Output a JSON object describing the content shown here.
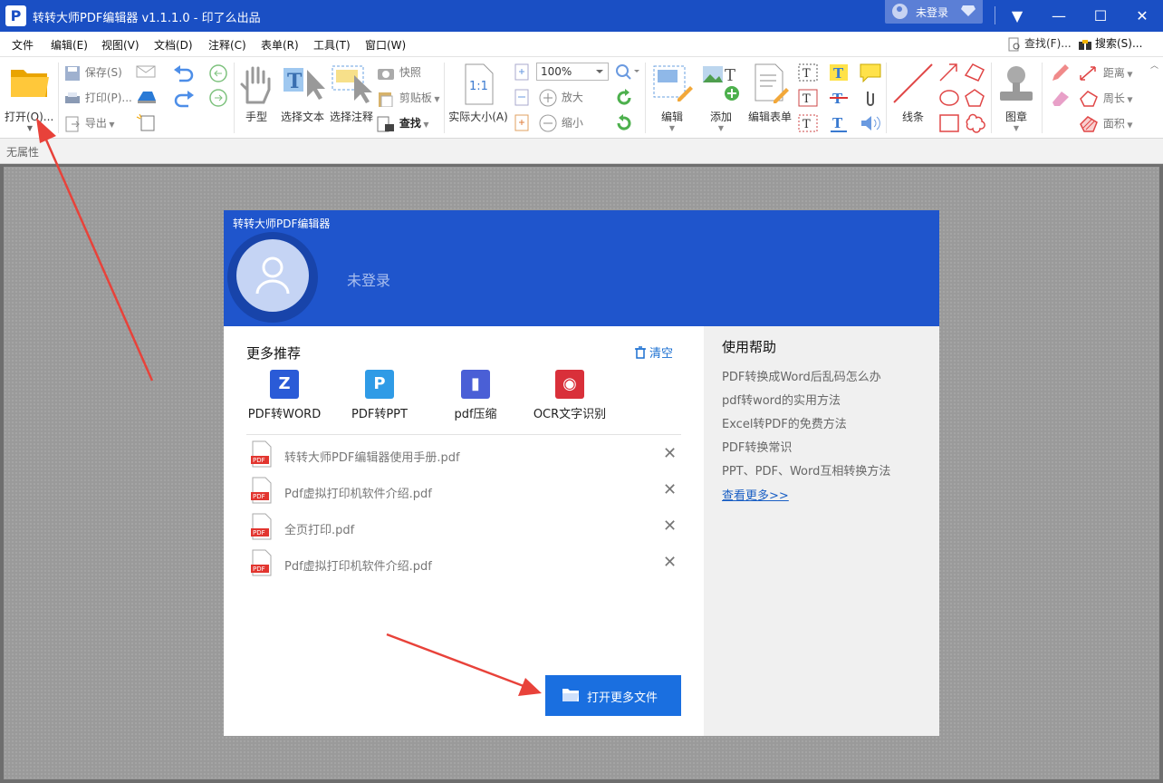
{
  "app": {
    "title": "转转大师PDF编辑器 v1.1.1.0 - 印了么出品",
    "logo_letter": "P",
    "login_label": "未登录",
    "window_controls": [
      "▼",
      "—",
      "☐",
      "✕"
    ]
  },
  "menu": {
    "items": [
      "文件",
      "编辑(E)",
      "视图(V)",
      "文档(D)",
      "注释(C)",
      "表单(R)",
      "工具(T)",
      "窗口(W)"
    ],
    "find_label": "查找(F)...",
    "search_label": "搜索(S)..."
  },
  "ribbon": {
    "open_label": "打开(O)...",
    "save_label": "保存(S)",
    "print_label": "打印(P)...",
    "export_label": "导出",
    "hand_label": "手型",
    "select_text_label": "选择文本",
    "select_annot_label": "选择注释",
    "snapshot_label": "快照",
    "clipboard_label": "剪贴板",
    "find_label": "查找",
    "actual_size_label": "实际大小(A)",
    "zoom_value": "100%",
    "zoom_in_label": "放大",
    "zoom_out_label": "缩小",
    "edit_label": "编辑",
    "add_label": "添加",
    "edit_form_label": "编辑表单",
    "lines_label": "线条",
    "stamp_label": "图章",
    "distance_label": "距离",
    "perimeter_label": "周长",
    "area_label": "面积"
  },
  "propbar": {
    "text": "无属性"
  },
  "dialog": {
    "title": "转转大师PDF编辑器",
    "user_status": "未登录",
    "recommend_title": "更多推荐",
    "clear_label": "清空",
    "tools": [
      {
        "label": "PDF转WORD",
        "color": "#2a5bd7",
        "glyph": "Z"
      },
      {
        "label": "PDF转PPT",
        "color": "#2f9be6",
        "glyph": "P"
      },
      {
        "label": "pdf压缩",
        "color": "#4a5fd6",
        "glyph": "▮"
      },
      {
        "label": "OCR文字识别",
        "color": "#d9303a",
        "glyph": "◉"
      }
    ],
    "files": [
      {
        "name": "转转大师PDF编辑器使用手册.pdf"
      },
      {
        "name": "Pdf虚拟打印机软件介绍.pdf"
      },
      {
        "name": "全页打印.pdf"
      },
      {
        "name": "Pdf虚拟打印机软件介绍.pdf"
      }
    ],
    "pdf_badge": "PDF",
    "close_glyph": "✕",
    "open_more_label": "打开更多文件",
    "help_title": "使用帮助",
    "help_links": [
      "PDF转换成Word后乱码怎么办",
      "pdf转word的实用方法",
      "Excel转PDF的免费方法",
      "PDF转换常识",
      "PPT、PDF、Word互相转换方法"
    ],
    "help_more": "查看更多>>"
  },
  "colors": {
    "titlebar": "#1a4fc4",
    "dialog_header": "#1f55cc",
    "accent_button": "#1a6fe0",
    "annotation_arrow": "#e8423a"
  }
}
